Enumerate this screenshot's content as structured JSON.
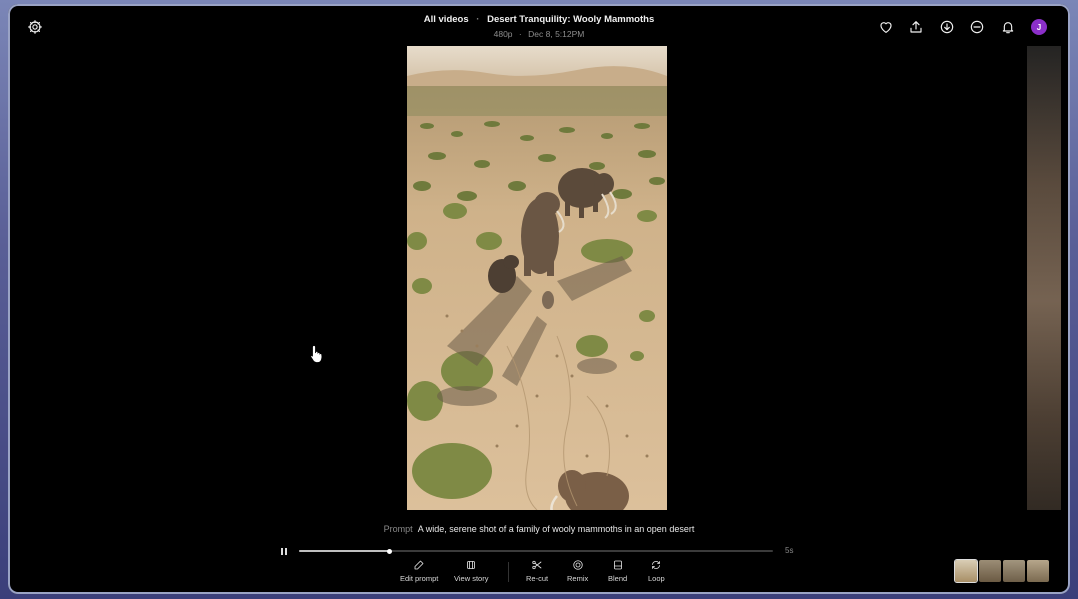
{
  "header": {
    "breadcrumb_root": "All videos",
    "separator": "·",
    "video_title": "Desert Tranquility: Wooly Mammoths",
    "resolution": "480p",
    "date": "Dec 8, 5:12PM"
  },
  "user": {
    "initial": "J",
    "avatar_color": "#8b2fc9"
  },
  "icons": {
    "top_left": "settings-icon",
    "top_right": [
      "heart-icon",
      "upload-icon",
      "download-icon",
      "minus-circle-icon",
      "bell-icon"
    ]
  },
  "prompt": {
    "label": "Prompt",
    "text": "A wide, serene shot of a family of wooly mammoths in an open desert"
  },
  "playback": {
    "progress_fraction": 0.19,
    "duration": "5s",
    "state": "playing"
  },
  "toolbar": {
    "edit_prompt": "Edit prompt",
    "view_story": "View story",
    "recut": "Re-cut",
    "remix": "Remix",
    "blend": "Blend",
    "loop": "Loop"
  },
  "colors": {
    "background": "#000000",
    "accent": "#8b2fc9"
  }
}
